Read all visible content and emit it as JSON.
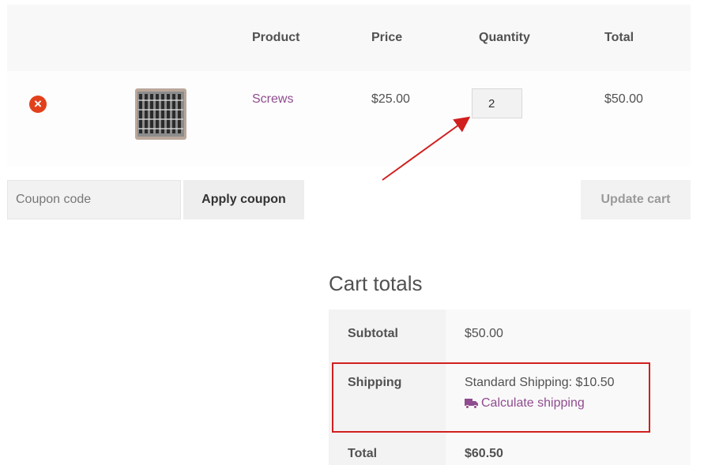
{
  "cart": {
    "headers": {
      "product": "Product",
      "price": "Price",
      "quantity": "Quantity",
      "total": "Total"
    },
    "items": [
      {
        "remove_icon": "remove-icon",
        "remove_glyph": "×",
        "thumbnail_icon": "product-thumbnail",
        "name": "Screws",
        "price": "$25.00",
        "quantity": "2",
        "total": "$50.00"
      }
    ]
  },
  "coupon": {
    "placeholder": "Coupon code",
    "apply_label": "Apply coupon"
  },
  "update_label": "Update cart",
  "totals": {
    "title": "Cart totals",
    "subtotal_label": "Subtotal",
    "subtotal_value": "$50.00",
    "shipping_label": "Shipping",
    "shipping_value": "Standard Shipping: $10.50",
    "calculate_label": "Calculate shipping",
    "calculate_icon": "truck-icon",
    "total_label": "Total",
    "total_value": "$60.50"
  },
  "colors": {
    "link": "#8f4c8f",
    "remove": "#e2401c",
    "annotation": "#d11f1f"
  }
}
